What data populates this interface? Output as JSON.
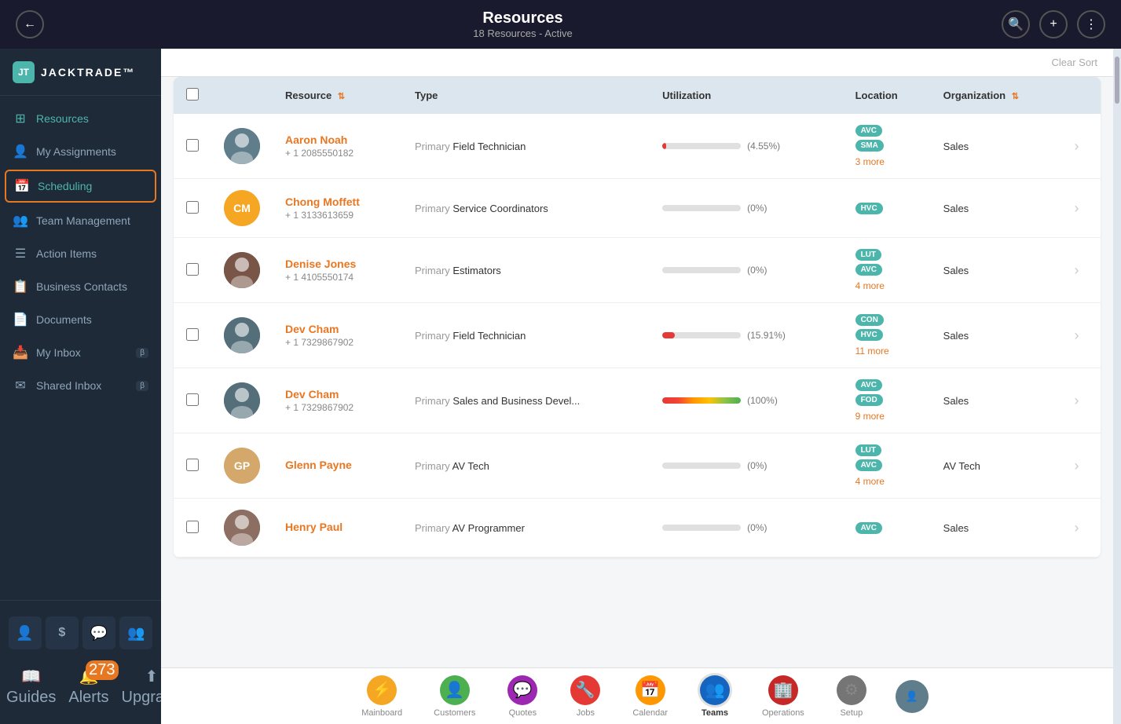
{
  "topBar": {
    "title": "Resources",
    "subtitle": "18 Resources - Active"
  },
  "sidebar": {
    "logo": {
      "iconText": "JT",
      "appName": "JACKTRADE™"
    },
    "navItems": [
      {
        "id": "resources",
        "label": "Resources",
        "icon": "⊞",
        "active": true
      },
      {
        "id": "my-assignments",
        "label": "My Assignments",
        "icon": "👤"
      },
      {
        "id": "scheduling",
        "label": "Scheduling",
        "icon": "📅",
        "highlighted": true
      },
      {
        "id": "team-management",
        "label": "Team Management",
        "icon": "👥"
      },
      {
        "id": "action-items",
        "label": "Action Items",
        "icon": "☰"
      },
      {
        "id": "business-contacts",
        "label": "Business Contacts",
        "icon": "📋"
      },
      {
        "id": "documents",
        "label": "Documents",
        "icon": "📄"
      },
      {
        "id": "my-inbox",
        "label": "My Inbox",
        "icon": "📥",
        "badge": "β"
      },
      {
        "id": "shared-inbox",
        "label": "Shared Inbox",
        "icon": "✉",
        "badge": "β"
      }
    ],
    "bottomIcons": [
      {
        "id": "person-icon",
        "icon": "👤"
      },
      {
        "id": "dollar-icon",
        "icon": "$"
      },
      {
        "id": "chat-icon",
        "icon": "💬"
      },
      {
        "id": "group-icon",
        "icon": "👥"
      }
    ],
    "bottomNav": [
      {
        "id": "guides",
        "label": "Guides",
        "icon": "📖"
      },
      {
        "id": "alerts",
        "label": "Alerts",
        "icon": "🔔",
        "badge": "273"
      },
      {
        "id": "upgrade",
        "label": "Upgrade",
        "icon": "⬆"
      }
    ]
  },
  "contentHeader": {
    "clearSortLabel": "Clear Sort"
  },
  "table": {
    "columns": [
      {
        "id": "checkbox",
        "label": ""
      },
      {
        "id": "avatar",
        "label": ""
      },
      {
        "id": "resource",
        "label": "Resource",
        "sortable": true
      },
      {
        "id": "type",
        "label": "Type"
      },
      {
        "id": "utilization",
        "label": "Utilization"
      },
      {
        "id": "location",
        "label": "Location"
      },
      {
        "id": "organization",
        "label": "Organization",
        "sortable": true
      },
      {
        "id": "action",
        "label": ""
      }
    ],
    "rows": [
      {
        "id": 1,
        "name": "Aaron Noah",
        "phone": "+ 1 2085550182",
        "avatarInitials": "",
        "avatarClass": "av-aaron",
        "avatarType": "photo",
        "type": "Field Technician",
        "utilPercent": 4.55,
        "utilLabel": "(4.55%)",
        "utilFillWidth": 5,
        "utilBarType": "red",
        "locations": [
          "AVC",
          "SMA"
        ],
        "moreLocations": "3 more",
        "organization": "Sales"
      },
      {
        "id": 2,
        "name": "Chong Moffett",
        "phone": "+ 1 3133613659",
        "avatarInitials": "CM",
        "avatarClass": "av-cm",
        "avatarType": "initials",
        "type": "Service Coordinators",
        "utilPercent": 0,
        "utilLabel": "(0%)",
        "utilFillWidth": 0,
        "utilBarType": "gray",
        "locations": [
          "HVC"
        ],
        "moreLocations": "",
        "organization": "Sales"
      },
      {
        "id": 3,
        "name": "Denise Jones",
        "phone": "+ 1 4105550174",
        "avatarInitials": "",
        "avatarClass": "av-denise",
        "avatarType": "photo",
        "type": "Estimators",
        "utilPercent": 0,
        "utilLabel": "(0%)",
        "utilFillWidth": 0,
        "utilBarType": "gray",
        "locations": [
          "LUT",
          "AVC"
        ],
        "moreLocations": "4 more",
        "organization": "Sales"
      },
      {
        "id": 4,
        "name": "Dev Cham",
        "phone": "+ 1 7329867902",
        "avatarInitials": "",
        "avatarClass": "av-dev1",
        "avatarType": "photo",
        "type": "Field Technician",
        "utilPercent": 15.91,
        "utilLabel": "(15.91%)",
        "utilFillWidth": 16,
        "utilBarType": "red",
        "locations": [
          "CON",
          "HVC"
        ],
        "moreLocations": "11 more",
        "organization": "Sales"
      },
      {
        "id": 5,
        "name": "Dev Cham",
        "phone": "+ 1 7329867902",
        "avatarInitials": "",
        "avatarClass": "av-dev2",
        "avatarType": "photo",
        "type": "Sales and Business Devel...",
        "utilPercent": 100,
        "utilLabel": "(100%)",
        "utilFillWidth": 100,
        "utilBarType": "rainbow",
        "locations": [
          "AVC",
          "FOD"
        ],
        "moreLocations": "9 more",
        "organization": "Sales"
      },
      {
        "id": 6,
        "name": "Glenn Payne",
        "phone": "",
        "avatarInitials": "GP",
        "avatarClass": "av-gp",
        "avatarType": "initials",
        "type": "AV Tech",
        "utilPercent": 0,
        "utilLabel": "(0%)",
        "utilFillWidth": 0,
        "utilBarType": "gray",
        "locations": [
          "LUT",
          "AVC"
        ],
        "moreLocations": "4 more",
        "organization": "AV Tech"
      },
      {
        "id": 7,
        "name": "Henry Paul",
        "phone": "",
        "avatarInitials": "",
        "avatarClass": "av-henry",
        "avatarType": "photo",
        "type": "AV Programmer",
        "utilPercent": 0,
        "utilLabel": "(0%)",
        "utilFillWidth": 0,
        "utilBarType": "gray",
        "locations": [
          "AVC"
        ],
        "moreLocations": "",
        "organization": "Sales"
      }
    ]
  },
  "bottomTabs": [
    {
      "id": "mainboard",
      "label": "Mainboard",
      "icon": "⚡",
      "colorClass": "tab-mainboard"
    },
    {
      "id": "customers",
      "label": "Customers",
      "icon": "👤",
      "colorClass": "tab-customers"
    },
    {
      "id": "quotes",
      "label": "Quotes",
      "icon": "💬",
      "colorClass": "tab-quotes"
    },
    {
      "id": "jobs",
      "label": "Jobs",
      "icon": "🔧",
      "colorClass": "tab-jobs"
    },
    {
      "id": "calendar",
      "label": "Calendar",
      "icon": "📅",
      "colorClass": "tab-calendar"
    },
    {
      "id": "teams",
      "label": "Teams",
      "icon": "👥",
      "colorClass": "tab-teams",
      "active": true
    },
    {
      "id": "operations",
      "label": "Operations",
      "icon": "🏢",
      "colorClass": "tab-operations"
    },
    {
      "id": "setup",
      "label": "Setup",
      "icon": "⚙",
      "colorClass": "tab-setup"
    }
  ]
}
